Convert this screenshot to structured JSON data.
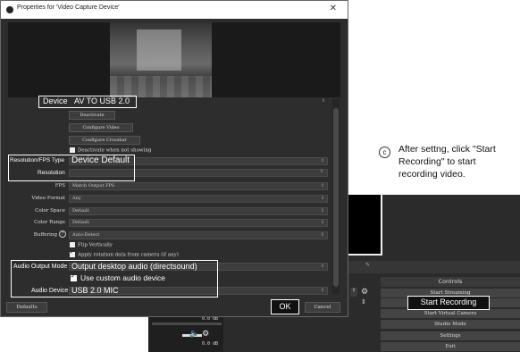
{
  "window": {
    "title": "Properties for 'Video Capture Device'",
    "close_glyph": "✕"
  },
  "device": {
    "label": "Device",
    "value": "AV TO USB 2.0"
  },
  "buttons": {
    "deactivate": "Deactivate",
    "configure_video": "Configure Video",
    "configure_crossbar": "Configure Crossbar"
  },
  "deactivate_when_not_showing": "Deactivate when not showing",
  "resolution_fps_type": {
    "label": "Resolution/FPS Type",
    "value": "Device Default"
  },
  "resolution": {
    "label": "Resolution",
    "value": ""
  },
  "fps": {
    "label": "FPS",
    "value": "Match Output FPS"
  },
  "video_format": {
    "label": "Video Format",
    "value": "Any"
  },
  "color_space": {
    "label": "Color Space",
    "value": "Default"
  },
  "color_range": {
    "label": "Color Range",
    "value": "Default"
  },
  "buffering": {
    "label": "Buffering",
    "value": "Auto-Detect"
  },
  "flip_vertically": "Flip Vertically",
  "apply_rotation": "Apply rotation data from camera (if any)",
  "audio_output_mode": {
    "label": "Audio Output Mode",
    "value": "Output desktop audio (directsound)"
  },
  "use_custom_audio": "Use custom audio device",
  "audio_device": {
    "label": "Audio Device",
    "value": "USB 2.0 MIC"
  },
  "footer": {
    "defaults": "Defaults",
    "ok": "OK",
    "cancel": "Cancel"
  },
  "obs_controls": {
    "header": "Controls",
    "start_streaming": "Start Streaming",
    "start_recording": "Start Recording",
    "start_virtual_camera": "Start Virtual Camera",
    "studio_mode": "Studio Mode",
    "settings": "Settings",
    "exit": "Exit"
  },
  "mixer": {
    "db1": "0.0 dB",
    "db2": "0.0 dB",
    "db3": "0.0 dB"
  },
  "annotation": {
    "marker": "c",
    "text": "After settng, click \"Start Recording\" to start recording video."
  },
  "colors": {
    "dialog_bg": "#2d2d2d",
    "highlight": "#ffffff",
    "obs_bg": "#2b2b2b"
  }
}
